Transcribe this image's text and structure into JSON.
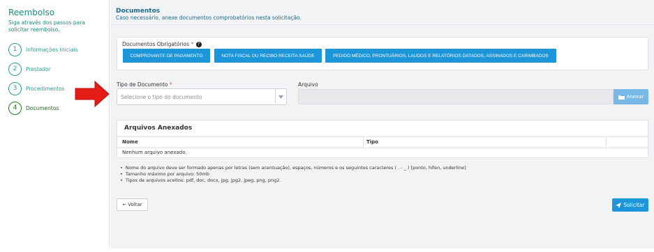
{
  "sidebar": {
    "title": "Reembolso",
    "subtitle": "Siga através dos passos para solicitar reembolso.",
    "steps": [
      {
        "number": "1",
        "label": "Informações Iniciais"
      },
      {
        "number": "2",
        "label": "Prestador"
      },
      {
        "number": "3",
        "label": "Procedimentos"
      },
      {
        "number": "4",
        "label": "Documentos"
      }
    ]
  },
  "main": {
    "title": "Documentos",
    "subtitle": "Caso necessário, anexe documentos comprobatórios nesta solicitação."
  },
  "required_docs": {
    "label": "Documentos Obrigatórios",
    "required_mark": "*",
    "help_icon_glyph": "?",
    "buttons": [
      "COMPROVANTE DE PAGAMENTO",
      "NOTA FISCAL OU RECIBO RECEITA SAÚDE",
      "PEDIDO MÉDICO, PRONTUÁRIOS, LAUDOS E RELATÓRIOS DATADOS, ASSINADOS E CARIMBADOS"
    ]
  },
  "form": {
    "doc_type_label": "Tipo de Documento",
    "required_mark": "*",
    "doc_type_placeholder": "Selecione o tipo do documento",
    "file_label": "Arquivo",
    "attach_button": "Anexar"
  },
  "files": {
    "title": "Arquivos Anexados",
    "columns": [
      "Nome",
      "Tipo"
    ],
    "empty_message": "Nenhum arquivo anexado."
  },
  "notes": [
    "Nome do arquivo deve ser formado apenas por letras (sem acentuação), espaços, números e os seguintes caracteres ( . - _ ) [ponto, hífen, underline]",
    "Tamanho máximo por arquivo: 50mb",
    "Tipos de arquivos aceitos: pdf, doc, docx, jpg, jpg2, jpeg, png, png2."
  ],
  "actions": {
    "back_label": "Voltar",
    "back_glyph": "←",
    "submit_label": "Solicitar"
  },
  "colors": {
    "accent": "#1c95d9",
    "sidebar_text": "#1a8a7c",
    "arrow": "#e41b17"
  }
}
